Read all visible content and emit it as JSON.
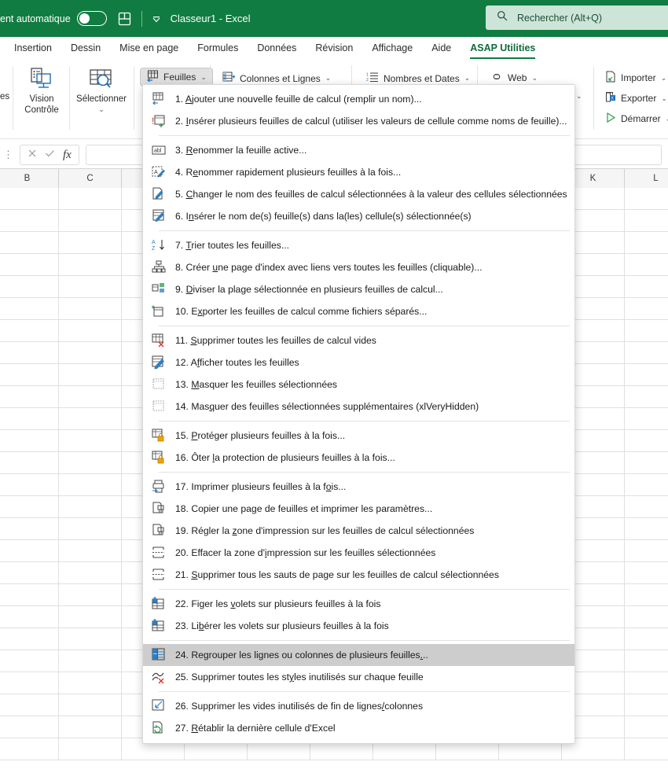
{
  "titlebar": {
    "autosave_label": "ent automatique",
    "autosave_state": "off",
    "save_icon": "save-icon",
    "qat_caret": "chevron-down-icon",
    "document_title": "Classeur1  -  Excel",
    "search_placeholder": "Rechercher (Alt+Q)",
    "search_icon": "search-icon",
    "bg_color": "#107c41"
  },
  "tabs": [
    {
      "label": "Insertion",
      "active": false
    },
    {
      "label": "Dessin",
      "active": false
    },
    {
      "label": "Mise en page",
      "active": false
    },
    {
      "label": "Formules",
      "active": false
    },
    {
      "label": "Données",
      "active": false
    },
    {
      "label": "Révision",
      "active": false
    },
    {
      "label": "Affichage",
      "active": false
    },
    {
      "label": "Aide",
      "active": false
    },
    {
      "label": "ASAP Utilities",
      "active": true
    }
  ],
  "ribbon": {
    "clipped_left_label": "es",
    "big_buttons": [
      {
        "label_line1": "Vision",
        "label_line2": "Contrôle",
        "icon": "vision-control-icon"
      },
      {
        "label_line1": "Sélectionner",
        "label_line2": "",
        "icon": "select-icon",
        "has_caret": true
      }
    ],
    "small_buttons": [
      {
        "label": "Feuilles",
        "icon": "sheets-icon",
        "pressed": true,
        "caret": true
      },
      {
        "label": "Colonnes et Lignes",
        "icon": "columns-rows-icon",
        "pressed": false,
        "caret": true
      },
      {
        "label": "Nombres et Dates",
        "icon": "numbers-dates-icon",
        "pressed": false,
        "caret": true
      },
      {
        "label": "Web",
        "icon": "web-icon",
        "pressed": false,
        "caret": true
      },
      {
        "label": "Importer",
        "icon": "import-icon",
        "pressed": false,
        "caret": true
      },
      {
        "label": "Exporter",
        "icon": "export-icon",
        "pressed": false,
        "caret": true
      },
      {
        "label": "Démarrer",
        "icon": "start-icon",
        "pressed": false,
        "caret": true
      }
    ],
    "overflow_caret": "chevron-down-icon"
  },
  "formula_bar": {
    "cancel_icon": "cancel-x-icon",
    "accept_icon": "accept-check-icon",
    "function_icon": "fx-icon",
    "value": "",
    "drag_handle": "vertical-dots-handle"
  },
  "grid": {
    "visible_column_headers": [
      "B",
      "C",
      "K",
      "L"
    ]
  },
  "menu": {
    "title": "Feuilles",
    "items": [
      {
        "n": 1,
        "pre": "1. ",
        "acc": "A",
        "post": "jouter une nouvelle feuille de calcul (remplir un nom)...",
        "icon": "add-sheet-icon",
        "sep_after": false,
        "selected": false
      },
      {
        "n": 2,
        "pre": "2. ",
        "acc": "I",
        "post": "nsérer plusieurs feuilles de calcul (utiliser les valeurs de cellule comme noms de feuille)...",
        "icon": "insert-sheets-icon",
        "sep_after": true,
        "selected": false
      },
      {
        "n": 3,
        "pre": "3. ",
        "acc": "R",
        "post": "enommer la feuille active...",
        "icon": "abl-rename-icon",
        "sep_after": false,
        "selected": false
      },
      {
        "n": 4,
        "pre": "4. R",
        "acc": "e",
        "post": "nommer rapidement plusieurs feuilles à la fois...",
        "icon": "quick-rename-icon",
        "sep_after": false,
        "selected": false
      },
      {
        "n": 5,
        "pre": "5. ",
        "acc": "C",
        "post": "hanger le nom des feuilles de calcul sélectionnées à la valeur des cellules sélectionnées",
        "icon": "rename-from-cells-icon",
        "sep_after": false,
        "selected": false
      },
      {
        "n": 6,
        "pre": "6. I",
        "acc": "n",
        "post": "sérer le nom de(s) feuille(s) dans la(les) cellule(s) sélectionnée(s)",
        "icon": "insert-sheetname-icon",
        "sep_after": true,
        "selected": false
      },
      {
        "n": 7,
        "pre": "7. ",
        "acc": "T",
        "post": "rier toutes les feuilles...",
        "icon": "sort-az-icon",
        "sep_after": false,
        "selected": false
      },
      {
        "n": 8,
        "pre": "8. Créer ",
        "acc": "u",
        "post": "ne page d'index avec liens vers toutes les feuilles (cliquable)...",
        "icon": "index-page-icon",
        "sep_after": false,
        "selected": false
      },
      {
        "n": 9,
        "pre": "9. ",
        "acc": "D",
        "post": "iviser la plage sélectionnée en plusieurs feuilles de calcul...",
        "icon": "split-range-icon",
        "sep_after": false,
        "selected": false
      },
      {
        "n": 10,
        "pre": "10. E",
        "acc": "x",
        "post": "porter les feuilles de calcul comme fichiers séparés...",
        "icon": "export-files-icon",
        "sep_after": true,
        "selected": false
      },
      {
        "n": 11,
        "pre": "11. ",
        "acc": "S",
        "post": "upprimer toutes les feuilles de calcul vides",
        "icon": "delete-empty-sheets-icon",
        "sep_after": false,
        "selected": false
      },
      {
        "n": 12,
        "pre": "12. A",
        "acc": "f",
        "post": "ficher toutes les feuilles",
        "icon": "unhide-sheets-icon",
        "sep_after": false,
        "selected": false
      },
      {
        "n": 13,
        "pre": "13. ",
        "acc": "M",
        "post": "asquer les feuilles sélectionnées",
        "icon": "hide-sheets-icon",
        "sep_after": false,
        "selected": false
      },
      {
        "n": 14,
        "pre": "14. Mas",
        "acc": "q",
        "post": "uer des feuilles sélectionnées supplémentaires (xlVeryHidden)",
        "icon": "very-hide-sheets-icon",
        "sep_after": true,
        "selected": false
      },
      {
        "n": 15,
        "pre": "15. ",
        "acc": "P",
        "post": "rotéger plusieurs feuilles à la fois...",
        "icon": "protect-sheets-icon",
        "sep_after": false,
        "selected": false
      },
      {
        "n": 16,
        "pre": "16. Ôter ",
        "acc": "l",
        "post": "a protection de plusieurs feuilles à la fois...",
        "icon": "unprotect-sheets-icon",
        "sep_after": true,
        "selected": false
      },
      {
        "n": 17,
        "pre": "17. Imprimer plusieurs feuilles à la f",
        "acc": "o",
        "post": "is...",
        "icon": "print-sheets-icon",
        "sep_after": false,
        "selected": false
      },
      {
        "n": 18,
        "pre": "18. Copier une pa",
        "acc": "g",
        "post": "e de feuilles et imprimer les paramètres...",
        "icon": "copy-page-setup-icon",
        "sep_after": false,
        "selected": false
      },
      {
        "n": 19,
        "pre": "19. Régler la ",
        "acc": "z",
        "post": "one d'impression sur les feuilles de calcul sélectionnées",
        "icon": "set-print-area-icon",
        "sep_after": false,
        "selected": false
      },
      {
        "n": 20,
        "pre": "20. Effacer  la zone d'",
        "acc": "i",
        "post": "mpression sur les feuilles sélectionnées",
        "icon": "clear-print-area-icon",
        "sep_after": false,
        "selected": false
      },
      {
        "n": 21,
        "pre": "21. ",
        "acc": "S",
        "post": "upprimer tous les sauts de page sur les feuilles de calcul sélectionnées",
        "icon": "remove-page-breaks-icon",
        "sep_after": true,
        "selected": false
      },
      {
        "n": 22,
        "pre": "22. Figer les ",
        "acc": "v",
        "post": "olets sur plusieurs feuilles à la fois",
        "icon": "freeze-panes-icon",
        "sep_after": false,
        "selected": false
      },
      {
        "n": 23,
        "pre": "23. Li",
        "acc": "b",
        "post": "érer les volets sur plusieurs feuilles à la fois",
        "icon": "unfreeze-panes-icon",
        "sep_after": true,
        "selected": false
      },
      {
        "n": 24,
        "pre": "24. Regrouper les lignes ou colonnes de plusieurs feuilles",
        "acc": ".",
        "post": "..",
        "icon": "group-rows-columns-icon",
        "sep_after": false,
        "selected": true
      },
      {
        "n": 25,
        "pre": "25. Supprimer toutes les  st",
        "acc": "y",
        "post": "les inutilisés sur chaque feuille",
        "icon": "remove-styles-icon",
        "sep_after": true,
        "selected": false
      },
      {
        "n": 26,
        "pre": "26. Supprimer les vides inutilisés de fin de lignes",
        "acc": "/",
        "post": "colonnes",
        "icon": "remove-trailing-blanks-icon",
        "sep_after": false,
        "selected": false
      },
      {
        "n": 27,
        "pre": "27. ",
        "acc": "R",
        "post": "établir la dernière cellule d'Excel",
        "icon": "reset-last-cell-icon",
        "sep_after": false,
        "selected": false
      }
    ],
    "highlight_color": "#cdcdcd"
  }
}
